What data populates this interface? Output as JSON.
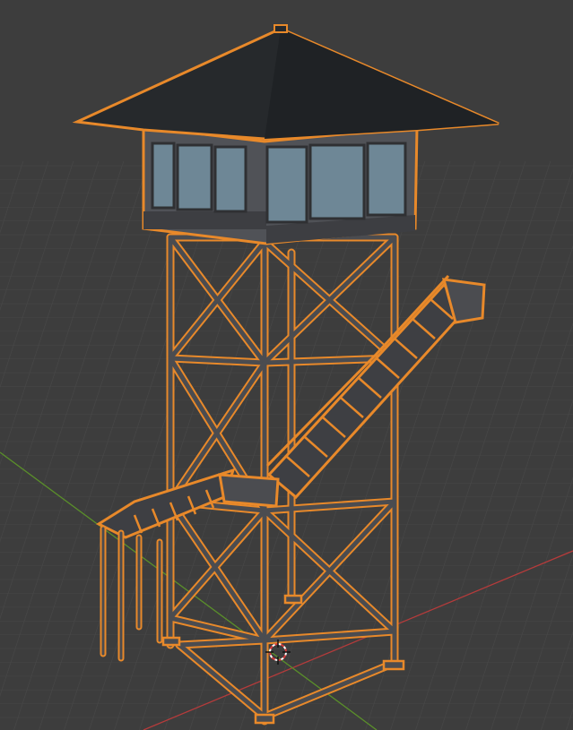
{
  "viewport": {
    "background": "#3d3d3d",
    "grid_color": "#4a4a4a",
    "axis_x_color": "#b53b3b",
    "axis_y_color": "#5a8f2a",
    "selection_outline_color": "#e8892a"
  },
  "scene": {
    "object_selected": true,
    "cursor_icon": "3d-cursor-icon"
  }
}
